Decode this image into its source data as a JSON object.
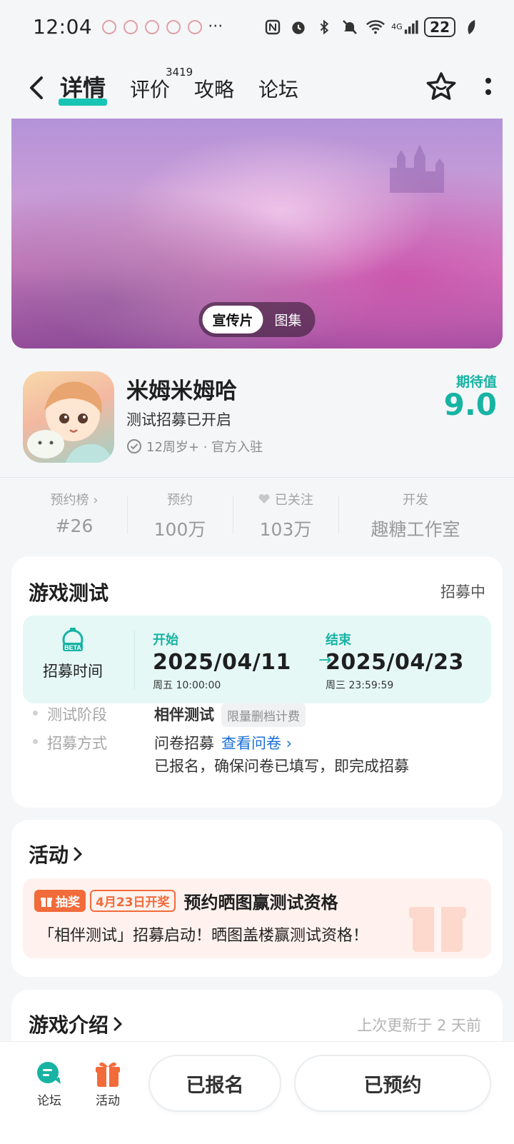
{
  "status_bar": {
    "time": "12:04",
    "more": "···",
    "network": "4G",
    "battery": "22"
  },
  "nav": {
    "tabs": [
      {
        "label": "详情",
        "active": true
      },
      {
        "label": "评价",
        "badge": "3419"
      },
      {
        "label": "攻略"
      },
      {
        "label": "论坛"
      }
    ]
  },
  "banner": {
    "options": [
      "宣传片",
      "图集"
    ],
    "active_option": "宣传片"
  },
  "game": {
    "title": "米姆米姆哈",
    "status": "测试招募已开启",
    "meta": "12周岁+ · 官方入驻",
    "expect_label": "期待值",
    "expect_value": "9.0"
  },
  "stats": [
    {
      "label": "预约榜 ›",
      "value": "#26"
    },
    {
      "label": "预约",
      "value": "100万"
    },
    {
      "label": "已关注",
      "value": "103万"
    },
    {
      "label": "开发",
      "value": "趣糖工作室"
    }
  ],
  "test": {
    "title": "游戏测试",
    "status": "招募中",
    "recruit_label": "招募时间",
    "start_label": "开始",
    "start_date": "2025/04/11",
    "start_time": "周五  10:00:00",
    "end_label": "结束",
    "end_date": "2025/04/23",
    "end_time": "周三  23:59:59",
    "arrow": "→",
    "phase_label": "测试阶段",
    "phase_value": "相伴测试",
    "phase_tag": "限量删档计费",
    "method_label": "招募方式",
    "method_value": "问卷招募",
    "method_link": "查看问卷 ›",
    "method_note": "已报名，确保问卷已填写，即完成招募"
  },
  "activity": {
    "title": "活动",
    "lottery_tag": "抽奖",
    "date_tag": "4月23日开奖",
    "headline": "预约晒图赢测试资格",
    "desc": "「相伴测试」招募启动！晒图盖楼赢测试资格！"
  },
  "intro": {
    "title": "游戏介绍",
    "updated": "上次更新于 2 天前"
  },
  "bottom": {
    "forum_label": "论坛",
    "activity_label": "活动",
    "signed_up": "已报名",
    "reserved": "已预约"
  },
  "colors": {
    "accent": "#17b3a3",
    "orange": "#f26b3a",
    "link": "#1a6fd6"
  }
}
